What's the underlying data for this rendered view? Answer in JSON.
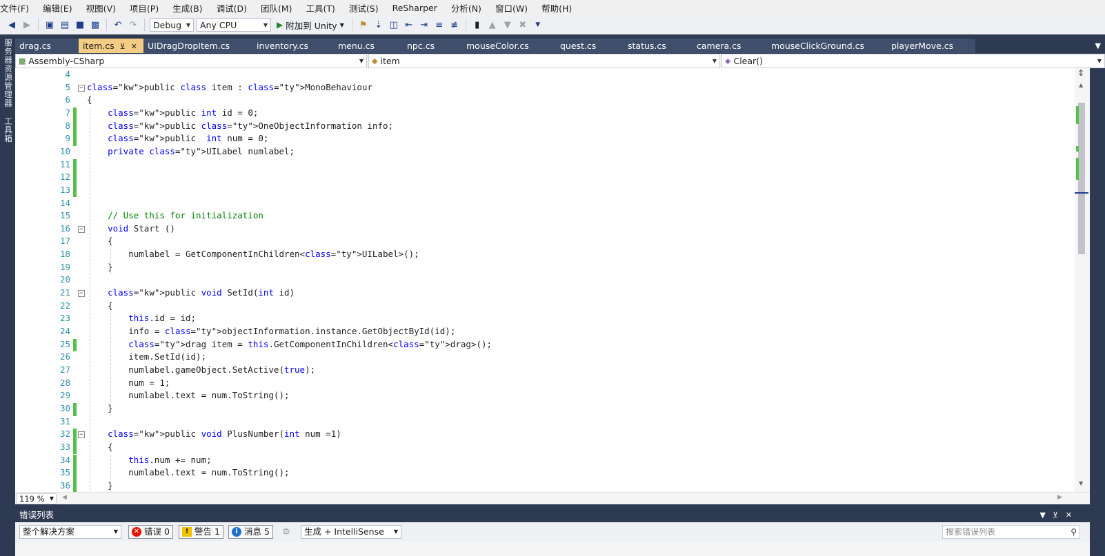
{
  "menu": [
    "文件(F)",
    "编辑(E)",
    "视图(V)",
    "项目(P)",
    "生成(B)",
    "调试(D)",
    "团队(M)",
    "工具(T)",
    "测试(S)",
    "ReSharper",
    "分析(N)",
    "窗口(W)",
    "帮助(H)"
  ],
  "toolbar": {
    "config": "Debug",
    "platform": "Any CPU",
    "run_label": "附加到 Unity"
  },
  "side_tabs": [
    "服务器资源管理器",
    "工具箱"
  ],
  "tabs": [
    {
      "label": "drag.cs",
      "active": false
    },
    {
      "label": "item.cs",
      "active": true
    },
    {
      "label": "UIDragDropItem.cs",
      "active": false
    },
    {
      "label": "inventory.cs",
      "active": false
    },
    {
      "label": "menu.cs",
      "active": false
    },
    {
      "label": "npc.cs",
      "active": false
    },
    {
      "label": "mouseColor.cs",
      "active": false
    },
    {
      "label": "quest.cs",
      "active": false
    },
    {
      "label": "status.cs",
      "active": false
    },
    {
      "label": "camera.cs",
      "active": false
    },
    {
      "label": "mouseClickGround.cs",
      "active": false
    },
    {
      "label": "playerMove.cs",
      "active": false
    }
  ],
  "nav": {
    "project": "Assembly-CSharp",
    "type": "item",
    "member": "Clear()"
  },
  "code_lines": [
    {
      "n": "4",
      "text": ""
    },
    {
      "n": "5",
      "text": "public class item : MonoBehaviour"
    },
    {
      "n": "6",
      "text": "{"
    },
    {
      "n": "7",
      "text": "    public int id = 0;"
    },
    {
      "n": "8",
      "text": "    public OneObjectInformation info;"
    },
    {
      "n": "9",
      "text": "    public  int num = 0;"
    },
    {
      "n": "10",
      "text": "    private UILabel numlabel;"
    },
    {
      "n": "11",
      "text": ""
    },
    {
      "n": "12",
      "text": ""
    },
    {
      "n": "13",
      "text": ""
    },
    {
      "n": "14",
      "text": ""
    },
    {
      "n": "15",
      "text": "    // Use this for initialization"
    },
    {
      "n": "16",
      "text": "    void Start ()"
    },
    {
      "n": "17",
      "text": "    {"
    },
    {
      "n": "18",
      "text": "        numlabel = GetComponentInChildren<UILabel>();"
    },
    {
      "n": "19",
      "text": "    }"
    },
    {
      "n": "20",
      "text": ""
    },
    {
      "n": "21",
      "text": "    public void SetId(int id)"
    },
    {
      "n": "22",
      "text": "    {"
    },
    {
      "n": "23",
      "text": "        this.id = id;"
    },
    {
      "n": "24",
      "text": "        info = objectInformation.instance.GetObjectById(id);"
    },
    {
      "n": "25",
      "text": "        drag item = this.GetComponentInChildren<drag>();"
    },
    {
      "n": "26",
      "text": "        item.SetId(id);"
    },
    {
      "n": "27",
      "text": "        numlabel.gameObject.SetActive(true);"
    },
    {
      "n": "28",
      "text": "        num = 1;"
    },
    {
      "n": "29",
      "text": "        numlabel.text = num.ToString();"
    },
    {
      "n": "30",
      "text": "    }"
    },
    {
      "n": "31",
      "text": ""
    },
    {
      "n": "32",
      "text": "    public void PlusNumber(int num =1)"
    },
    {
      "n": "33",
      "text": "    {"
    },
    {
      "n": "34",
      "text": "        this.num += num;"
    },
    {
      "n": "35",
      "text": "        numlabel.text = num.ToString();"
    },
    {
      "n": "36",
      "text": "    }"
    }
  ],
  "zoom": "119 %",
  "error_list": {
    "title": "错误列表",
    "scope": "整个解决方案",
    "errors": "错误 0",
    "warnings": "警告 1",
    "messages": "消息 5",
    "filter": "生成 + IntelliSense",
    "search_placeholder": "搜索错误列表"
  },
  "colors": {
    "accent_tab": "#f5cc84",
    "frame": "#2d3a52",
    "keyword": "#0000ff",
    "type": "#2b91af",
    "comment": "#008000",
    "change_bar": "#57c04a"
  }
}
